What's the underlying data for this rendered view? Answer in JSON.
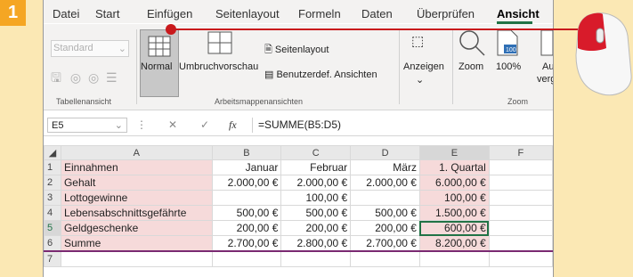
{
  "step_number": "1",
  "menu": [
    "Datei",
    "Start",
    "Einfügen",
    "Seitenlayout",
    "Formeln",
    "Daten",
    "Überprüfen",
    "Ansicht"
  ],
  "ribbon": {
    "standard": "Standard",
    "normal": "Normal",
    "umbruch": "Umbruchvorschau",
    "seitenlayout": "Seitenlayout",
    "benutzerdef": "Benutzerdef. Ansichten",
    "anzeigen": "Anzeigen",
    "zoom": "Zoom",
    "zoom100": "100%",
    "au": "Au",
    "verg": "verg",
    "icon100": "100",
    "grp_tabellen": "Tabellenansicht",
    "grp_arbeits": "Arbeitsmappenansichten",
    "grp_zoom": "Zoom"
  },
  "formula_bar": {
    "name": "E5",
    "cancel": "✕",
    "ok": "✓",
    "fx": "fx",
    "formula": "=SUMME(B5:D5)"
  },
  "columns": [
    "A",
    "B",
    "C",
    "D",
    "E",
    "F"
  ],
  "rows": [
    {
      "n": "1",
      "a": "Einnahmen",
      "b": "Januar",
      "c": "Februar",
      "d": "März",
      "e": "1. Quartal"
    },
    {
      "n": "2",
      "a": "Gehalt",
      "b": "2.000,00 €",
      "c": "2.000,00 €",
      "d": "2.000,00 €",
      "e": "6.000,00 €"
    },
    {
      "n": "3",
      "a": "Lottogewinne",
      "b": "",
      "c": "100,00 €",
      "d": "",
      "e": "100,00 €"
    },
    {
      "n": "4",
      "a": "Lebensabschnittsgefährte",
      "b": "500,00 €",
      "c": "500,00 €",
      "d": "500,00 €",
      "e": "1.500,00 €"
    },
    {
      "n": "5",
      "a": "Geldgeschenke",
      "b": "200,00 €",
      "c": "200,00 €",
      "d": "200,00 €",
      "e": "600,00 €"
    },
    {
      "n": "6",
      "a": "Summe",
      "b": "2.700,00 €",
      "c": "2.800,00 €",
      "d": "2.700,00 €",
      "e": "8.200,00 €"
    },
    {
      "n": "7",
      "a": "",
      "b": "",
      "c": "",
      "d": "",
      "e": ""
    }
  ],
  "colors": {
    "accent": "#217346",
    "highlight": "#f6dada",
    "annotation": "#c9191c"
  }
}
